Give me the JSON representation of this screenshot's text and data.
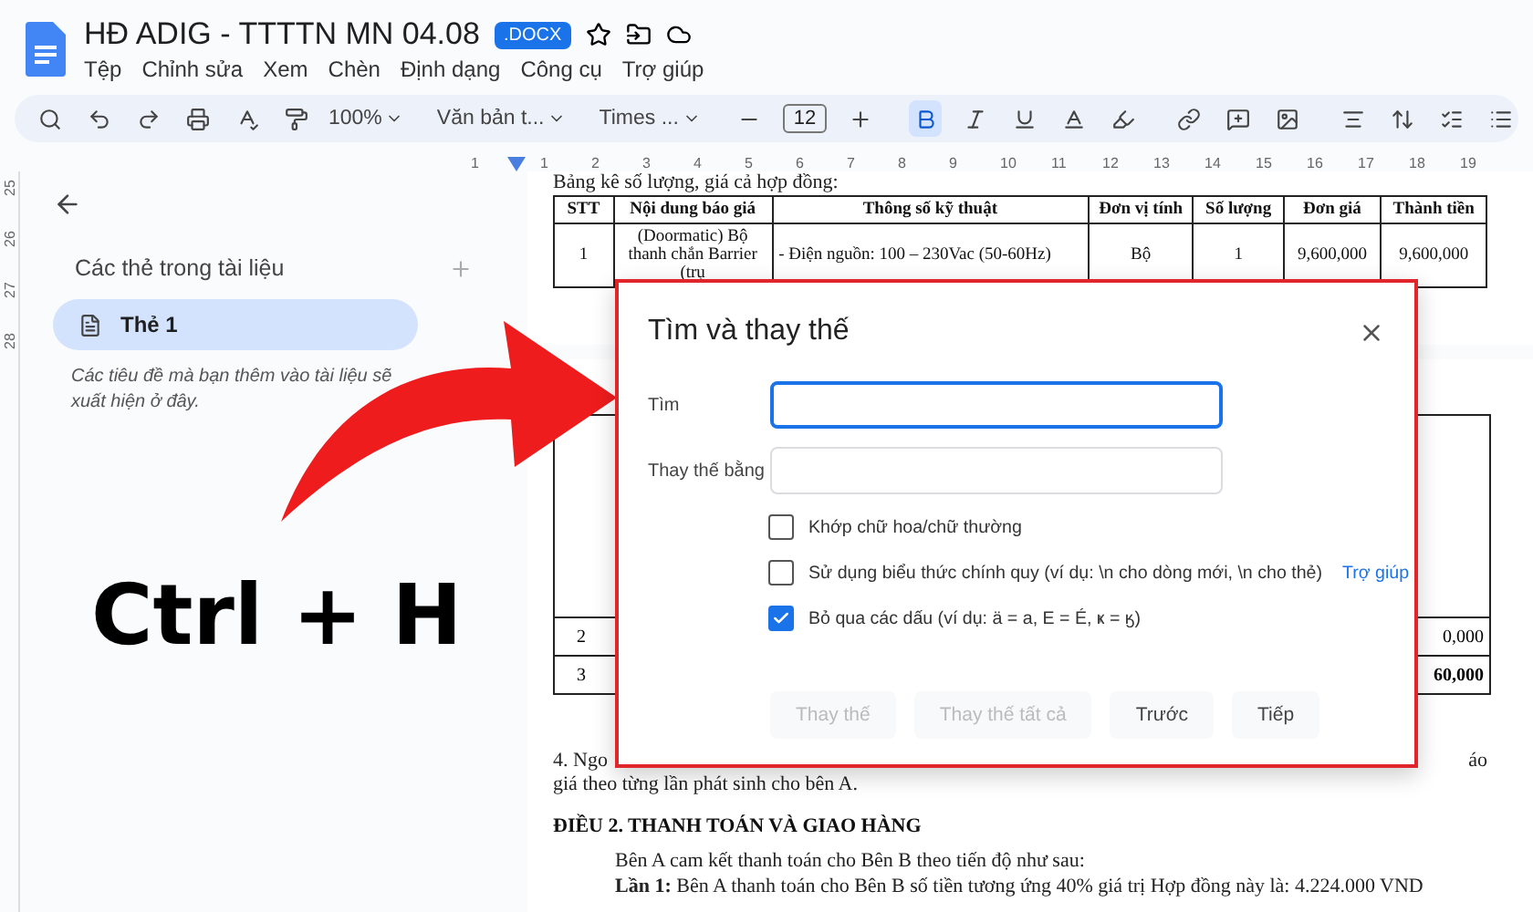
{
  "document": {
    "title": "HĐ ADIG - TTTTN MN 04.08",
    "badge": ".DOCX"
  },
  "menu": [
    "Tệp",
    "Chỉnh sửa",
    "Xem",
    "Chèn",
    "Định dạng",
    "Công cụ",
    "Trợ giúp"
  ],
  "toolbar": {
    "zoom": "100%",
    "style": "Văn bản t...",
    "font": "Times ...",
    "font_size": "12",
    "bold_selected": true
  },
  "ruler": {
    "left_label": "1",
    "labels": [
      "1",
      "2",
      "3",
      "4",
      "5",
      "6",
      "7",
      "8",
      "9",
      "10",
      "11",
      "12",
      "13",
      "14",
      "15",
      "16",
      "17",
      "18",
      "19"
    ],
    "side_labels": [
      "25",
      "26",
      "27",
      "28"
    ]
  },
  "sidebar": {
    "heading": "Các thẻ trong tài liệu",
    "tabs": [
      {
        "label": "Thẻ 1",
        "selected": true
      }
    ],
    "hint": "Các tiêu đề mà bạn thêm vào tài liệu sẽ xuất hiện ở đây."
  },
  "page": {
    "intro": "Bảng kê số lượng, giá cả hợp đồng:",
    "table": {
      "columns": [
        "STT",
        "Nội dung báo giá",
        "Thông số kỹ thuật",
        "Đơn vị tính",
        "Số lượng",
        "Đơn giá",
        "Thành tiền"
      ],
      "rows": [
        [
          "1",
          "(Doormatic) Bộ thanh chắn Barrier (trụ",
          "-     Điện nguồn: 100 – 230Vac (50-60Hz)",
          "Bộ",
          "1",
          "9,600,000",
          "9,600,000"
        ]
      ]
    },
    "table_2_rows": [
      {
        "number": "2",
        "amount": "0,000"
      },
      {
        "number": "3",
        "amount": "60,000"
      }
    ],
    "para_start": "4. Ngo",
    "para_end": "áo",
    "para_line": "giá theo từng lần phát sinh cho bên A.",
    "heading": "ĐIỀU 2. THANH TOÁN VÀ GIAO HÀNG",
    "body": "Bên A cam kết thanh toán cho Bên B theo tiến độ như sau:",
    "last_line": "**Lần 1:** Bên A thanh toán cho Bên B số tiền tương ứng 40% giá trị Hợp đồng này là: 4.224.000 VND"
  },
  "dialog": {
    "title": "Tìm và thay thế",
    "fields": [
      {
        "label": "Tìm",
        "focused": true
      },
      {
        "label": "Thay thế bằng",
        "focused": false
      }
    ],
    "options": [
      {
        "label": "Khớp chữ hoa/chữ thường",
        "checked": false
      },
      {
        "label": "Sử dụng biểu thức chính quy (ví dụ: \\n cho dòng mới, \\n cho thẻ)",
        "link": "Trợ giúp",
        "checked": false
      },
      {
        "label": "Bỏ qua các dấu (ví dụ: ä = a, E = É, ҝ = ӄ)",
        "checked": true
      }
    ],
    "buttons": [
      {
        "label": "Thay thế",
        "disabled": true
      },
      {
        "label": "Thay thế tất cả",
        "disabled": true
      },
      {
        "label": "Trước",
        "disabled": false
      },
      {
        "label": "Tiếp",
        "disabled": false
      }
    ]
  },
  "overlay": {
    "shortcut": "Ctrl + H"
  }
}
